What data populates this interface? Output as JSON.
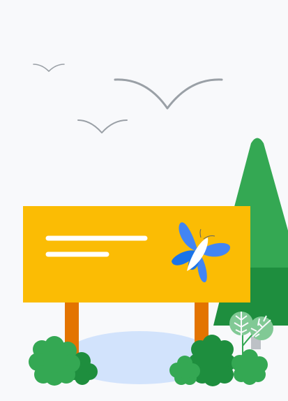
{
  "illustration": {
    "background_color": "#f8f9fb",
    "sign": {
      "board_color": "#fbbc04",
      "post_color": "#e37400",
      "text_line_color": "#ffffff",
      "text_lines_count": 2,
      "logo": {
        "icon": "butterfly-icon",
        "colors": [
          "#4285f4",
          "#1a73e8",
          "#ffffff"
        ]
      }
    },
    "trees": {
      "light_green": "#34a853",
      "dark_green": "#1e8e3e",
      "trunk_color": "#bdc1c6"
    },
    "bushes": {
      "colors": [
        "#34a853",
        "#1e8e3e"
      ]
    },
    "ground_shadow_color": "#d2e3fc",
    "birds": {
      "count": 3,
      "color": "#9aa0a6"
    },
    "plant": {
      "leaf_color": "#81c995",
      "stem_color": "#34a853"
    }
  }
}
